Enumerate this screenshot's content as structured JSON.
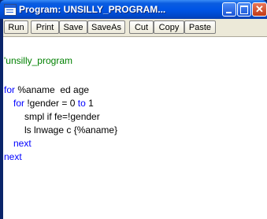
{
  "window": {
    "title": "Program: UNSILLY_PROGRAM...",
    "close_glyph": "✕",
    "icons": [
      "app-icon",
      "minimize-icon",
      "maximize-icon",
      "close-icon"
    ]
  },
  "toolbar": {
    "buttons": [
      "Run",
      "Print",
      "Save",
      "SaveAs",
      "Cut",
      "Copy",
      "Paste"
    ]
  },
  "editor": {
    "line1": "'unsilly_program",
    "line2": "",
    "line3_kw": "for",
    "line3_rest": " %aname  ed age",
    "line4_kw1": "for",
    "line4_mid": " !gender = 0 ",
    "line4_kw2": "to",
    "line4_rest": " 1",
    "line5": "smpl if fe=!gender",
    "line6": "ls lnwage c {%aname}",
    "line7": "next",
    "line8": "next"
  },
  "colors": {
    "titlebar": "#0055e5",
    "keyword": "#0000ff",
    "comment": "#008000",
    "toolbar_bg": "#ece9d8"
  }
}
